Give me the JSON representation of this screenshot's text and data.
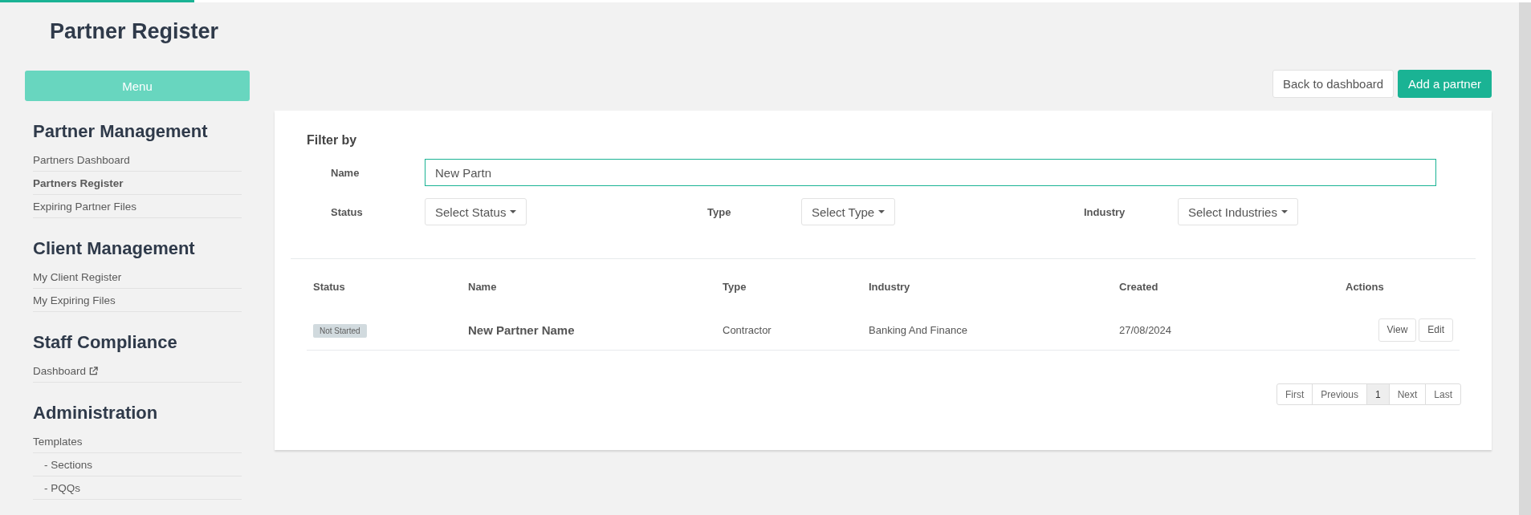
{
  "loading_bar": {
    "level": 0.127
  },
  "page_title": "Partner Register",
  "menu_button": "Menu",
  "sidebar": {
    "sections": [
      {
        "heading": "Partner Management",
        "items": [
          {
            "label": "Partners Dashboard",
            "selected": false,
            "external": false,
            "sub": false
          },
          {
            "label": "Partners Register",
            "selected": true,
            "external": false,
            "sub": false
          },
          {
            "label": "Expiring Partner Files",
            "selected": false,
            "external": false,
            "sub": false
          }
        ]
      },
      {
        "heading": "Client Management",
        "items": [
          {
            "label": "My Client Register",
            "selected": false,
            "external": false,
            "sub": false
          },
          {
            "label": "My Expiring Files",
            "selected": false,
            "external": false,
            "sub": false
          }
        ]
      },
      {
        "heading": "Staff Compliance",
        "items": [
          {
            "label": "Dashboard",
            "selected": false,
            "external": true,
            "sub": false
          }
        ]
      },
      {
        "heading": "Administration",
        "items": [
          {
            "label": "Templates",
            "selected": false,
            "external": false,
            "sub": false
          },
          {
            "label": "- Sections",
            "selected": false,
            "external": false,
            "sub": true
          },
          {
            "label": "- PQQs",
            "selected": false,
            "external": false,
            "sub": true
          }
        ]
      }
    ]
  },
  "header_buttons": [
    {
      "label": "Back to dashboard",
      "kind": "default"
    },
    {
      "label": "Add a partner",
      "kind": "primary"
    }
  ],
  "filter": {
    "heading": "Filter by",
    "name_label": "Name",
    "name_value": "New Partn",
    "dropdowns": [
      {
        "label": "Status",
        "value": "Select Status"
      },
      {
        "label": "Type",
        "value": "Select Type"
      },
      {
        "label": "Industry",
        "value": "Select Industries"
      }
    ]
  },
  "table": {
    "columns": [
      "Status",
      "Name",
      "Type",
      "Industry",
      "Created",
      "Actions"
    ],
    "rows": [
      {
        "status": "Not Started",
        "name": "New Partner Name",
        "type": "Contractor",
        "industry": "Banking And Finance",
        "created": "27/08/2024",
        "actions": [
          "View",
          "Edit"
        ]
      }
    ]
  },
  "pagination": [
    {
      "label": "First",
      "selected": false
    },
    {
      "label": "Previous",
      "selected": false
    },
    {
      "label": "1",
      "selected": true
    },
    {
      "label": "Next",
      "selected": false
    },
    {
      "label": "Last",
      "selected": false
    }
  ]
}
